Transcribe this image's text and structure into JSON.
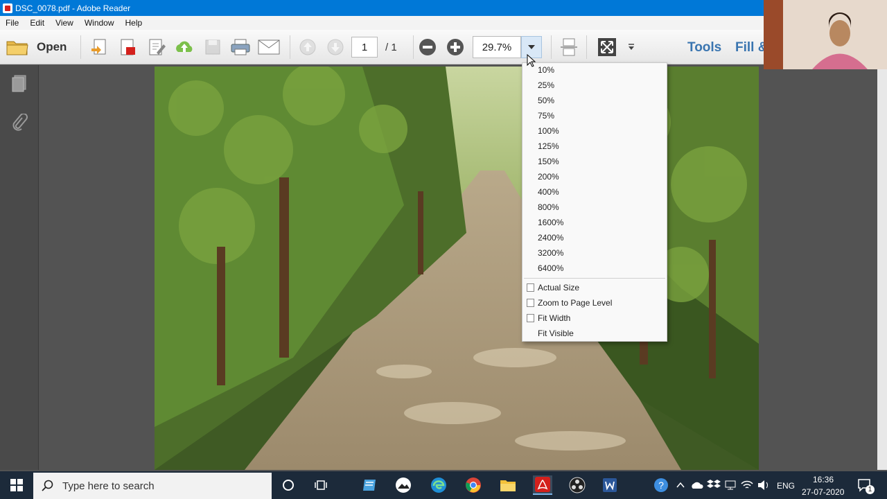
{
  "window": {
    "title": "DSC_0078.pdf - Adobe Reader"
  },
  "menu": [
    "File",
    "Edit",
    "View",
    "Window",
    "Help"
  ],
  "toolbar": {
    "open_label": "Open",
    "page_current": "1",
    "page_total": "/ 1",
    "zoom_value": "29.7%",
    "tools_label": "Tools",
    "fill_label": "Fill &"
  },
  "zoom_menu": {
    "levels": [
      "10%",
      "25%",
      "50%",
      "75%",
      "100%",
      "125%",
      "150%",
      "200%",
      "400%",
      "800%",
      "1600%",
      "2400%",
      "3200%",
      "6400%"
    ],
    "actual_size": "Actual Size",
    "zoom_to_page_level": "Zoom to Page Level",
    "fit_width": "Fit Width",
    "fit_visible": "Fit Visible"
  },
  "taskbar": {
    "search_placeholder": "Type here to search",
    "language": "ENG",
    "time": "16:36",
    "date": "27-07-2020",
    "notification_count": "1"
  },
  "colors": {
    "titlebar": "#0078d7",
    "accent_tools": "#3a75b0",
    "taskbar": "#1c2a3a"
  }
}
